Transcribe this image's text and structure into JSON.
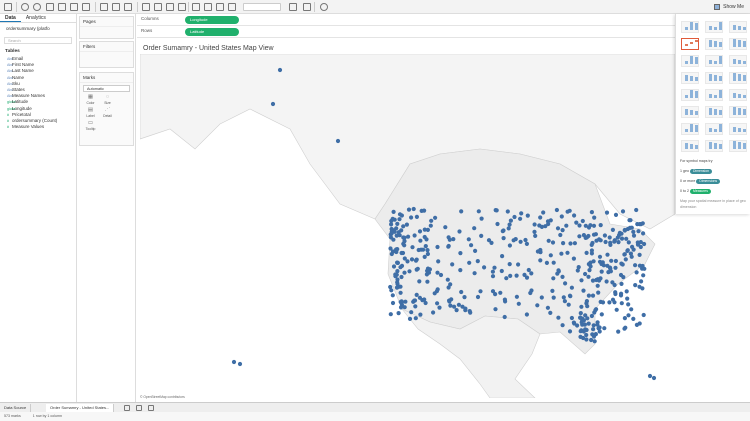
{
  "toolbar": {
    "show_me_label": "Show Me"
  },
  "data_pane": {
    "tabs": [
      "Data",
      "Analytics"
    ],
    "datasource": "ordersummary (platfo",
    "search_placeholder": "Search",
    "tables_label": "Tables",
    "fields": [
      {
        "name": "Email",
        "kind": "dimension",
        "type_icon": "Abc"
      },
      {
        "name": "First Name",
        "kind": "dimension",
        "type_icon": "Abc"
      },
      {
        "name": "Last Name",
        "kind": "dimension",
        "type_icon": "Abc"
      },
      {
        "name": "Name",
        "kind": "dimension",
        "type_icon": "Abc"
      },
      {
        "name": "Sku",
        "kind": "dimension",
        "type_icon": "Abc"
      },
      {
        "name": "States",
        "kind": "dimension",
        "type_icon": "Abc"
      },
      {
        "name": "Measure Names",
        "kind": "dimension",
        "type_icon": "Abc"
      },
      {
        "name": "Latitude",
        "kind": "measure",
        "type_icon": "globe"
      },
      {
        "name": "Longitude",
        "kind": "measure",
        "type_icon": "globe"
      },
      {
        "name": "Pricetotal",
        "kind": "measure",
        "type_icon": "#"
      },
      {
        "name": "ordersummary (Count)",
        "kind": "measure",
        "type_icon": "#"
      },
      {
        "name": "Measure Values",
        "kind": "measure",
        "type_icon": "#"
      }
    ]
  },
  "cards": {
    "pages": "Pages",
    "filters": "Filters",
    "marks": "Marks",
    "mark_type": "Automatic",
    "mark_buttons": [
      "Color",
      "Size",
      "Label",
      "Detail",
      "Tooltip"
    ]
  },
  "shelves": {
    "columns_label": "Columns",
    "columns_pill": "Longitude",
    "rows_label": "Rows",
    "rows_pill": "Latitude"
  },
  "view": {
    "title": "Order Sumamry - United States Map View",
    "attribution": "© OpenStreetMap contributors"
  },
  "show_me": {
    "hint_title": "For symbol maps try",
    "hint_rows": [
      {
        "prefix": "1 geo",
        "pill": "Dimension"
      },
      {
        "prefix": "0 or more",
        "pill": "Dimensions"
      },
      {
        "prefix": "0 to 2",
        "pill": "Measures"
      }
    ],
    "hint_sub": "Map your spatial measure in place of geo dimension"
  },
  "bottom": {
    "datasource_tab": "Data Source",
    "sheet_tab": "Order Sumamry - United States..."
  },
  "status": {
    "marks": "573 marks",
    "rows_cols": "1 row by 1 column"
  },
  "colors": {
    "point": "#3f6ea6",
    "pill_green": "#20b06c",
    "water": "#ffffff",
    "land_us": "#ececec",
    "land_other": "#f4f4f4"
  },
  "icons": [
    "undo-icon",
    "redo-icon",
    "save-icon",
    "new-datasource-icon",
    "show-me-icon",
    "share-icon",
    "filter-icon",
    "globe-icon"
  ]
}
